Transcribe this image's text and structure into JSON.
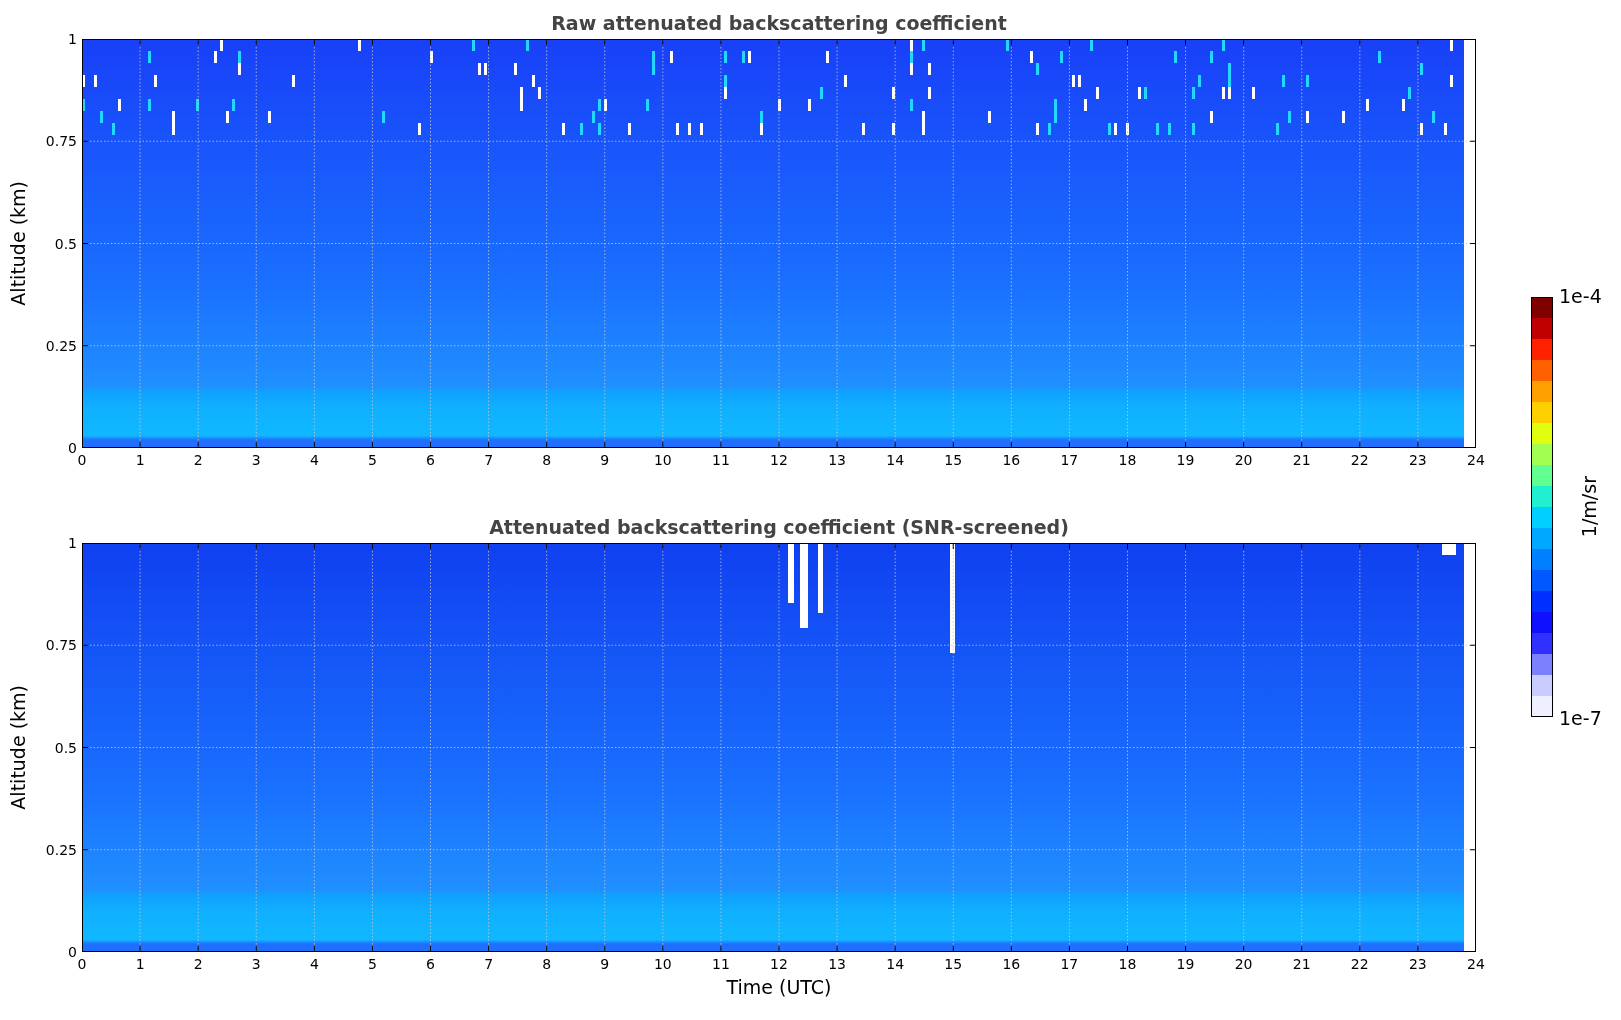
{
  "panels": [
    {
      "title": "Raw attenuated backscattering coefficient",
      "ylabel": "Altitude (km)",
      "yticks": [
        "1",
        "0.75",
        "0.5",
        "0.25",
        "0"
      ],
      "xticks": [
        "0",
        "1",
        "2",
        "3",
        "4",
        "5",
        "6",
        "7",
        "8",
        "9",
        "10",
        "11",
        "12",
        "13",
        "14",
        "15",
        "16",
        "17",
        "18",
        "19",
        "20",
        "21",
        "22",
        "23",
        "24"
      ],
      "screened": false
    },
    {
      "title": "Attenuated backscattering coefficient (SNR-screened)",
      "ylabel": "Altitude (km)",
      "yticks": [
        "1",
        "0.75",
        "0.5",
        "0.25",
        "0"
      ],
      "xticks": [
        "0",
        "1",
        "2",
        "3",
        "4",
        "5",
        "6",
        "7",
        "8",
        "9",
        "10",
        "11",
        "12",
        "13",
        "14",
        "15",
        "16",
        "17",
        "18",
        "19",
        "20",
        "21",
        "22",
        "23",
        "24"
      ],
      "screened": true
    }
  ],
  "xlabel": "Time (UTC)",
  "colorbar": {
    "max_label": "1e-4",
    "label": "1/m/sr",
    "min_label": "1e-7"
  }
}
